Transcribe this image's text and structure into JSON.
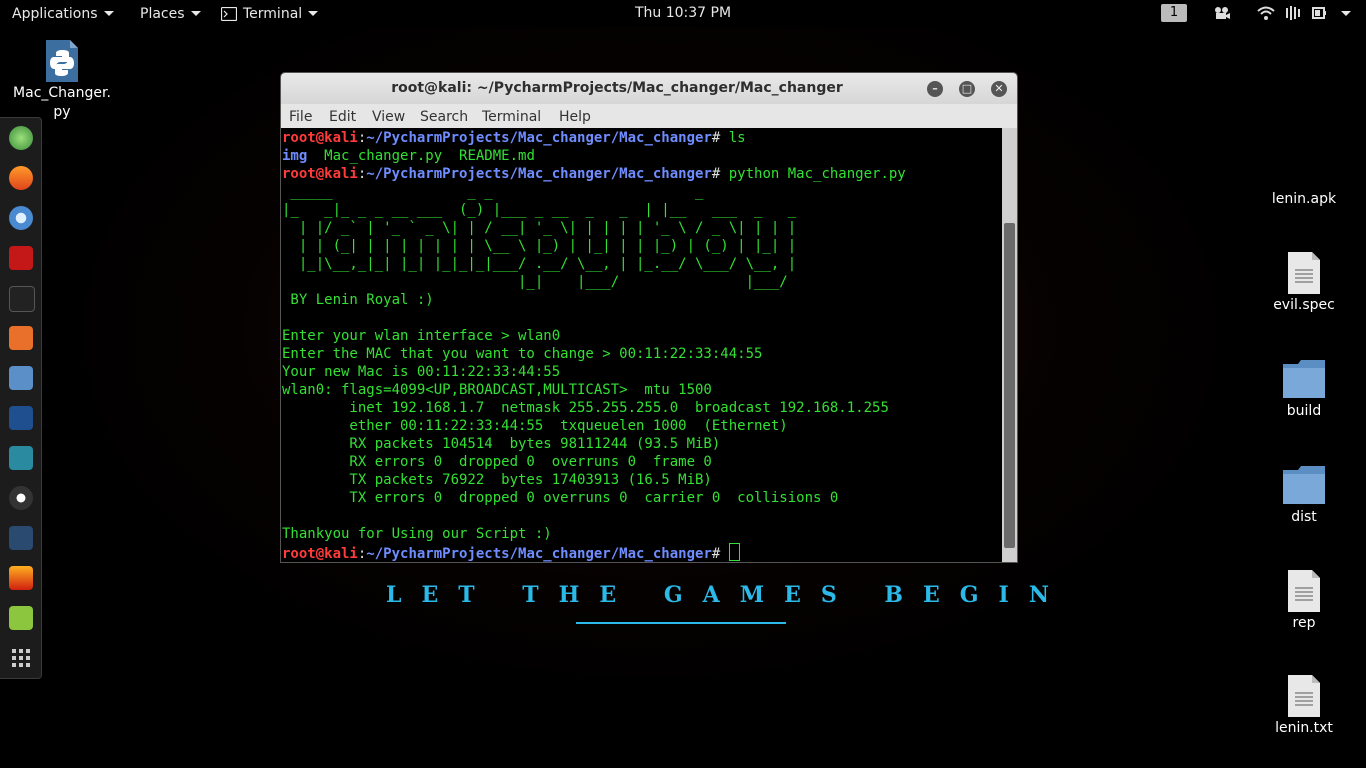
{
  "topbar": {
    "applications": "Applications",
    "places": "Places",
    "terminal_app": "Terminal",
    "clock": "Thu 10:37 PM",
    "workspace": "1"
  },
  "desktop": {
    "icons_left": [
      {
        "name": "Mac_Changer.py",
        "type": "python-file"
      }
    ],
    "icons_right": [
      {
        "name": "lenin.apk",
        "type": "file"
      },
      {
        "name": "evil.spec",
        "type": "file"
      },
      {
        "name": "build",
        "type": "folder"
      },
      {
        "name": "dist",
        "type": "folder"
      },
      {
        "name": "rep",
        "type": "file"
      },
      {
        "name": "lenin.txt",
        "type": "file"
      }
    ],
    "wallpaper_text": "LET THE GAMES BEGIN"
  },
  "dock": {
    "items": [
      "globe-icon",
      "firefox-icon",
      "chromium-icon",
      "armitage-icon",
      "terminal-icon",
      "burpsuite-icon",
      "files-icon",
      "metasploit-icon",
      "maltego-icon",
      "ghost-icon",
      "faraday-icon",
      "flashfire-icon",
      "notes-icon",
      "show-apps-icon"
    ]
  },
  "terminal": {
    "title": "root@kali: ~/PycharmProjects/Mac_changer/Mac_changer",
    "menu": [
      "File",
      "Edit",
      "View",
      "Search",
      "Terminal",
      "Help"
    ],
    "prompt_user": "root@kali",
    "prompt_path": "~/PycharmProjects/Mac_changer/Mac_changer",
    "cmd1": "ls",
    "ls_dir": "img",
    "ls_files": "  Mac_changer.py  README.md",
    "cmd2": "python Mac_changer.py",
    "banner": [
      " _____                _ _                        _",
      "|_   _|_ _ _ __ ___  (_) |___ _ __  _   _  | |__   ___  _   _",
      "  | |/ _` | '_ ` _ \\| | / __| '_ \\| | | | | '_ \\ / _ \\| | | |",
      "  | | (_| | | | | | | | \\__ \\ |_) | |_| | | |_) | (_) | |_| |",
      "  |_|\\__,_|_| |_| |_|_|_|___/ .__/ \\__, | |_.__/ \\___/ \\__, |",
      "                            |_|    |___/               |___/"
    ],
    "byline": " BY Lenin Royal :)",
    "output": [
      "Enter your wlan interface > wlan0",
      "Enter the MAC that you want to change > 00:11:22:33:44:55",
      "Your new Mac is 00:11:22:33:44:55",
      "wlan0: flags=4099<UP,BROADCAST,MULTICAST>  mtu 1500",
      "        inet 192.168.1.7  netmask 255.255.255.0  broadcast 192.168.1.255",
      "        ether 00:11:22:33:44:55  txqueuelen 1000  (Ethernet)",
      "        RX packets 104514  bytes 98111244 (93.5 MiB)",
      "        RX errors 0  dropped 0  overruns 0  frame 0",
      "        TX packets 76922  bytes 17403913 (16.5 MiB)",
      "        TX errors 0  dropped 0 overruns 0  carrier 0  collisions 0"
    ],
    "thanks": "Thankyou for Using our Script :)"
  },
  "colors": {
    "terminal_text": "#33e033",
    "prompt_user": "#ff3b3b",
    "prompt_path": "#6f8dff",
    "wallpaper_accent": "#2bb9e8"
  }
}
